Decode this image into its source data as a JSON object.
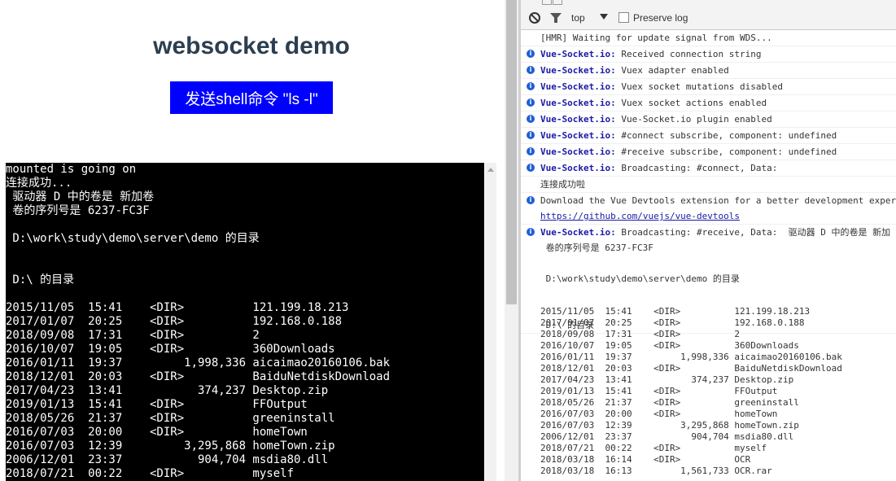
{
  "app": {
    "title": "websocket demo",
    "send_button": "发送shell命令 \"ls -l\"",
    "terminal_lines": [
      "mounted is going on",
      "连接成功...",
      " 驱动器 D 中的卷是 新加卷",
      " 卷的序列号是 6237-FC3F",
      "",
      " D:\\work\\study\\demo\\server\\demo 的目录",
      "",
      "",
      " D:\\ 的目录",
      "",
      "2015/11/05  15:41    <DIR>          121.199.18.213",
      "2017/01/07  20:25    <DIR>          192.168.0.188",
      "2018/09/08  17:31    <DIR>          2",
      "2016/10/07  19:05    <DIR>          360Downloads",
      "2016/01/11  19:37         1,998,336 aicaimao20160106.bak",
      "2018/12/01  20:03    <DIR>          BaiduNetdiskDownload",
      "2017/04/23  13:41           374,237 Desktop.zip",
      "2019/01/13  15:41    <DIR>          FFOutput",
      "2018/05/26  21:37    <DIR>          greeninstall",
      "2016/07/03  20:00    <DIR>          homeTown",
      "2016/07/03  12:39         3,295,868 homeTown.zip",
      "2006/12/01  23:37           904,704 msdia80.dll",
      "2018/07/21  00:22    <DIR>          myself"
    ]
  },
  "devtools": {
    "context": "top",
    "preserve_log": "Preserve log",
    "messages": [
      {
        "type": "log",
        "source": "",
        "text": "[HMR] Waiting for update signal from WDS..."
      },
      {
        "type": "info",
        "source": "Vue-Socket.io:",
        "text": " Received connection string"
      },
      {
        "type": "info",
        "source": "Vue-Socket.io:",
        "text": " Vuex adapter enabled"
      },
      {
        "type": "info",
        "source": "Vue-Socket.io:",
        "text": " Vuex socket mutations disabled"
      },
      {
        "type": "info",
        "source": "Vue-Socket.io:",
        "text": " Vuex socket actions enabled"
      },
      {
        "type": "info",
        "source": "Vue-Socket.io:",
        "text": " Vue-Socket.io plugin enabled"
      },
      {
        "type": "info",
        "source": "Vue-Socket.io:",
        "text": " #connect subscribe, component: undefined"
      },
      {
        "type": "info",
        "source": "Vue-Socket.io:",
        "text": " #receive subscribe, component: undefined"
      },
      {
        "type": "info",
        "source": "Vue-Socket.io:",
        "text": " Broadcasting: #connect, Data:"
      },
      {
        "type": "log",
        "source": "",
        "text": "连接成功啦"
      },
      {
        "type": "info",
        "source": "",
        "text": "Download the Vue Devtools extension for a better development experi",
        "link": "https://github.com/vuejs/vue-devtools"
      },
      {
        "type": "info",
        "source": "Vue-Socket.io:",
        "text": " Broadcasting: #receive, Data:  驱动器 D 中的卷是 新加",
        "body": " 卷的序列号是 6237-FC3F\n\n D:\\work\\study\\demo\\server\\demo 的目录\n\n\n D:\\ 的目录"
      }
    ],
    "dir_listing": [
      "2015/11/05  15:41    <DIR>          121.199.18.213",
      "2017/01/07  20:25    <DIR>          192.168.0.188",
      "2018/09/08  17:31    <DIR>          2",
      "2016/10/07  19:05    <DIR>          360Downloads",
      "2016/01/11  19:37         1,998,336 aicaimao20160106.bak",
      "2018/12/01  20:03    <DIR>          BaiduNetdiskDownload",
      "2017/04/23  13:41           374,237 Desktop.zip",
      "2019/01/13  15:41    <DIR>          FFOutput",
      "2018/05/26  21:37    <DIR>          greeninstall",
      "2016/07/03  20:00    <DIR>          homeTown",
      "2016/07/03  12:39         3,295,868 homeTown.zip",
      "2006/12/01  23:37           904,704 msdia80.dll",
      "2018/07/21  00:22    <DIR>          myself",
      "2018/03/18  16:14    <DIR>          OCR",
      "2018/03/18  16:13         1,561,733 OCR.rar"
    ]
  }
}
